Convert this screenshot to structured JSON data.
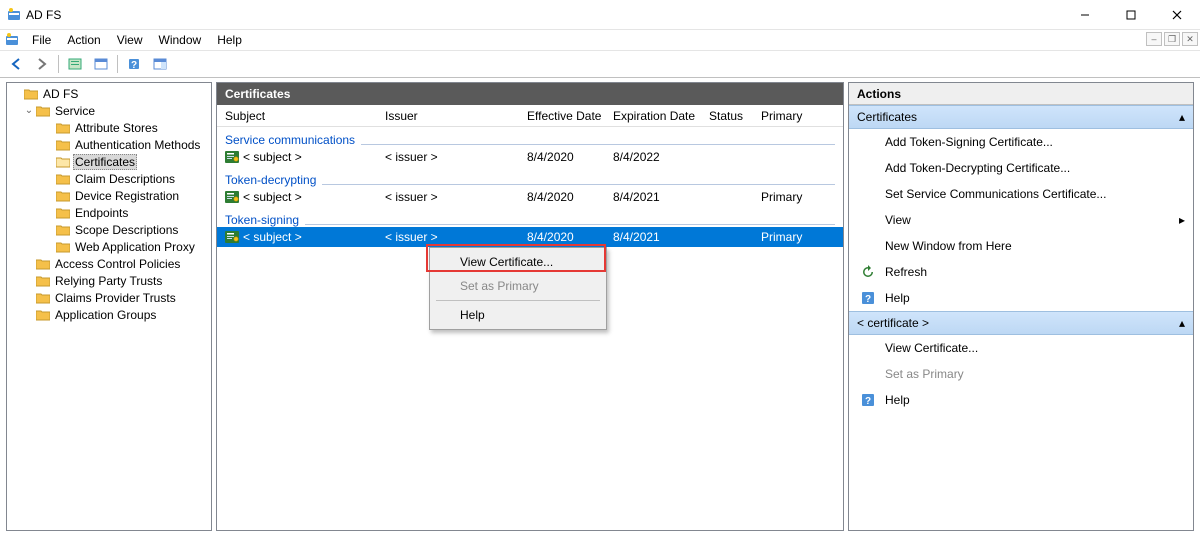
{
  "title": "AD FS",
  "menu": [
    "File",
    "Action",
    "View",
    "Window",
    "Help"
  ],
  "tree": {
    "root": "AD FS",
    "service": "Service",
    "service_children": [
      "Attribute Stores",
      "Authentication Methods",
      "Certificates",
      "Claim Descriptions",
      "Device Registration",
      "Endpoints",
      "Scope Descriptions",
      "Web Application Proxy"
    ],
    "siblings": [
      "Access Control Policies",
      "Relying Party Trusts",
      "Claims Provider Trusts",
      "Application Groups"
    ],
    "selected_index": 2
  },
  "main": {
    "header": "Certificates",
    "columns": [
      "Subject",
      "Issuer",
      "Effective Date",
      "Expiration Date",
      "Status",
      "Primary"
    ],
    "groups": [
      {
        "label": "Service communications",
        "rows": [
          {
            "subject": "< subject >",
            "issuer": "< issuer >",
            "effective": "8/4/2020",
            "expires": "8/4/2022",
            "status": "",
            "primary": ""
          }
        ]
      },
      {
        "label": "Token-decrypting",
        "rows": [
          {
            "subject": "< subject >",
            "issuer": "< issuer >",
            "effective": "8/4/2020",
            "expires": "8/4/2021",
            "status": "",
            "primary": "Primary"
          }
        ]
      },
      {
        "label": "Token-signing",
        "rows": [
          {
            "subject": "< subject >",
            "issuer": "< issuer >",
            "effective": "8/4/2020",
            "expires": "8/4/2021",
            "status": "",
            "primary": "Primary",
            "selected": true
          }
        ]
      }
    ]
  },
  "context_menu": {
    "items": [
      {
        "label": "View Certificate...",
        "enabled": true
      },
      {
        "label": "Set as Primary",
        "enabled": false
      },
      {
        "sep": true
      },
      {
        "label": "Help",
        "enabled": true
      }
    ],
    "highlighted_index": 0
  },
  "actions": {
    "header": "Actions",
    "sections": [
      {
        "title": "Certificates",
        "items": [
          {
            "icon": "",
            "label": "Add Token-Signing Certificate..."
          },
          {
            "icon": "",
            "label": "Add Token-Decrypting Certificate..."
          },
          {
            "icon": "",
            "label": "Set Service Communications Certificate..."
          },
          {
            "icon": "",
            "label": "View",
            "arrow": true
          },
          {
            "icon": "",
            "label": "New Window from Here"
          },
          {
            "icon": "refresh",
            "label": "Refresh"
          },
          {
            "icon": "help",
            "label": "Help"
          }
        ]
      },
      {
        "title": "< certificate >",
        "items": [
          {
            "icon": "",
            "label": "View Certificate..."
          },
          {
            "icon": "",
            "label": "Set as Primary",
            "disabled": true
          },
          {
            "icon": "help",
            "label": "Help"
          }
        ]
      }
    ]
  }
}
